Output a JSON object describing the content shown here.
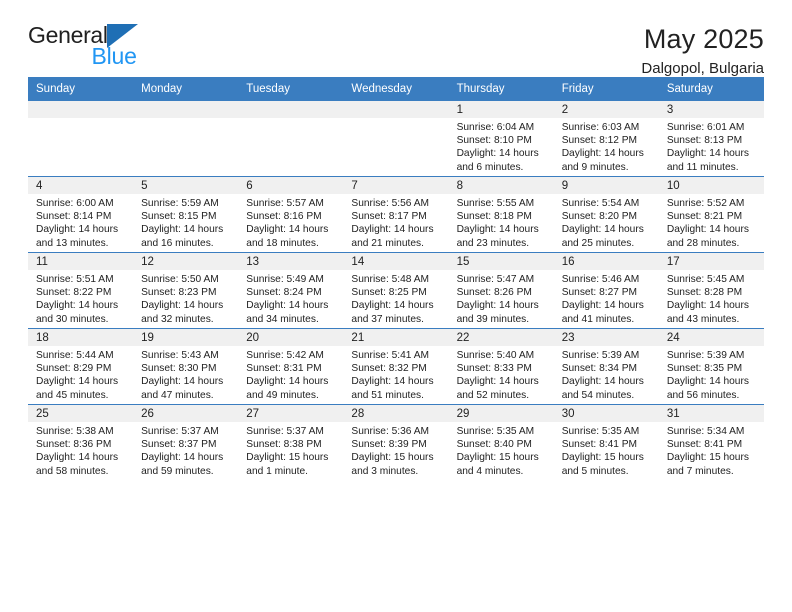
{
  "brand": {
    "name_part1": "General",
    "name_part2": "Blue",
    "accent_color": "#2196f3",
    "triangle_color": "#1f6fb5"
  },
  "header": {
    "title": "May 2025",
    "location": "Dalgopol, Bulgaria"
  },
  "calendar": {
    "header_bg": "#3a7dc0",
    "header_text_color": "#ffffff",
    "daynum_bg": "#f0f0f0",
    "weekday_headers": [
      "Sunday",
      "Monday",
      "Tuesday",
      "Wednesday",
      "Thursday",
      "Friday",
      "Saturday"
    ],
    "weeks": [
      [
        {
          "day": "",
          "empty": true,
          "sunrise": "",
          "sunset": "",
          "daylight_line1": "",
          "daylight_line2": ""
        },
        {
          "day": "",
          "empty": true,
          "sunrise": "",
          "sunset": "",
          "daylight_line1": "",
          "daylight_line2": ""
        },
        {
          "day": "",
          "empty": true,
          "sunrise": "",
          "sunset": "",
          "daylight_line1": "",
          "daylight_line2": ""
        },
        {
          "day": "",
          "empty": true,
          "sunrise": "",
          "sunset": "",
          "daylight_line1": "",
          "daylight_line2": ""
        },
        {
          "day": "1",
          "empty": false,
          "sunrise": "Sunrise: 6:04 AM",
          "sunset": "Sunset: 8:10 PM",
          "daylight_line1": "Daylight: 14 hours",
          "daylight_line2": "and 6 minutes."
        },
        {
          "day": "2",
          "empty": false,
          "sunrise": "Sunrise: 6:03 AM",
          "sunset": "Sunset: 8:12 PM",
          "daylight_line1": "Daylight: 14 hours",
          "daylight_line2": "and 9 minutes."
        },
        {
          "day": "3",
          "empty": false,
          "sunrise": "Sunrise: 6:01 AM",
          "sunset": "Sunset: 8:13 PM",
          "daylight_line1": "Daylight: 14 hours",
          "daylight_line2": "and 11 minutes."
        }
      ],
      [
        {
          "day": "4",
          "empty": false,
          "sunrise": "Sunrise: 6:00 AM",
          "sunset": "Sunset: 8:14 PM",
          "daylight_line1": "Daylight: 14 hours",
          "daylight_line2": "and 13 minutes."
        },
        {
          "day": "5",
          "empty": false,
          "sunrise": "Sunrise: 5:59 AM",
          "sunset": "Sunset: 8:15 PM",
          "daylight_line1": "Daylight: 14 hours",
          "daylight_line2": "and 16 minutes."
        },
        {
          "day": "6",
          "empty": false,
          "sunrise": "Sunrise: 5:57 AM",
          "sunset": "Sunset: 8:16 PM",
          "daylight_line1": "Daylight: 14 hours",
          "daylight_line2": "and 18 minutes."
        },
        {
          "day": "7",
          "empty": false,
          "sunrise": "Sunrise: 5:56 AM",
          "sunset": "Sunset: 8:17 PM",
          "daylight_line1": "Daylight: 14 hours",
          "daylight_line2": "and 21 minutes."
        },
        {
          "day": "8",
          "empty": false,
          "sunrise": "Sunrise: 5:55 AM",
          "sunset": "Sunset: 8:18 PM",
          "daylight_line1": "Daylight: 14 hours",
          "daylight_line2": "and 23 minutes."
        },
        {
          "day": "9",
          "empty": false,
          "sunrise": "Sunrise: 5:54 AM",
          "sunset": "Sunset: 8:20 PM",
          "daylight_line1": "Daylight: 14 hours",
          "daylight_line2": "and 25 minutes."
        },
        {
          "day": "10",
          "empty": false,
          "sunrise": "Sunrise: 5:52 AM",
          "sunset": "Sunset: 8:21 PM",
          "daylight_line1": "Daylight: 14 hours",
          "daylight_line2": "and 28 minutes."
        }
      ],
      [
        {
          "day": "11",
          "empty": false,
          "sunrise": "Sunrise: 5:51 AM",
          "sunset": "Sunset: 8:22 PM",
          "daylight_line1": "Daylight: 14 hours",
          "daylight_line2": "and 30 minutes."
        },
        {
          "day": "12",
          "empty": false,
          "sunrise": "Sunrise: 5:50 AM",
          "sunset": "Sunset: 8:23 PM",
          "daylight_line1": "Daylight: 14 hours",
          "daylight_line2": "and 32 minutes."
        },
        {
          "day": "13",
          "empty": false,
          "sunrise": "Sunrise: 5:49 AM",
          "sunset": "Sunset: 8:24 PM",
          "daylight_line1": "Daylight: 14 hours",
          "daylight_line2": "and 34 minutes."
        },
        {
          "day": "14",
          "empty": false,
          "sunrise": "Sunrise: 5:48 AM",
          "sunset": "Sunset: 8:25 PM",
          "daylight_line1": "Daylight: 14 hours",
          "daylight_line2": "and 37 minutes."
        },
        {
          "day": "15",
          "empty": false,
          "sunrise": "Sunrise: 5:47 AM",
          "sunset": "Sunset: 8:26 PM",
          "daylight_line1": "Daylight: 14 hours",
          "daylight_line2": "and 39 minutes."
        },
        {
          "day": "16",
          "empty": false,
          "sunrise": "Sunrise: 5:46 AM",
          "sunset": "Sunset: 8:27 PM",
          "daylight_line1": "Daylight: 14 hours",
          "daylight_line2": "and 41 minutes."
        },
        {
          "day": "17",
          "empty": false,
          "sunrise": "Sunrise: 5:45 AM",
          "sunset": "Sunset: 8:28 PM",
          "daylight_line1": "Daylight: 14 hours",
          "daylight_line2": "and 43 minutes."
        }
      ],
      [
        {
          "day": "18",
          "empty": false,
          "sunrise": "Sunrise: 5:44 AM",
          "sunset": "Sunset: 8:29 PM",
          "daylight_line1": "Daylight: 14 hours",
          "daylight_line2": "and 45 minutes."
        },
        {
          "day": "19",
          "empty": false,
          "sunrise": "Sunrise: 5:43 AM",
          "sunset": "Sunset: 8:30 PM",
          "daylight_line1": "Daylight: 14 hours",
          "daylight_line2": "and 47 minutes."
        },
        {
          "day": "20",
          "empty": false,
          "sunrise": "Sunrise: 5:42 AM",
          "sunset": "Sunset: 8:31 PM",
          "daylight_line1": "Daylight: 14 hours",
          "daylight_line2": "and 49 minutes."
        },
        {
          "day": "21",
          "empty": false,
          "sunrise": "Sunrise: 5:41 AM",
          "sunset": "Sunset: 8:32 PM",
          "daylight_line1": "Daylight: 14 hours",
          "daylight_line2": "and 51 minutes."
        },
        {
          "day": "22",
          "empty": false,
          "sunrise": "Sunrise: 5:40 AM",
          "sunset": "Sunset: 8:33 PM",
          "daylight_line1": "Daylight: 14 hours",
          "daylight_line2": "and 52 minutes."
        },
        {
          "day": "23",
          "empty": false,
          "sunrise": "Sunrise: 5:39 AM",
          "sunset": "Sunset: 8:34 PM",
          "daylight_line1": "Daylight: 14 hours",
          "daylight_line2": "and 54 minutes."
        },
        {
          "day": "24",
          "empty": false,
          "sunrise": "Sunrise: 5:39 AM",
          "sunset": "Sunset: 8:35 PM",
          "daylight_line1": "Daylight: 14 hours",
          "daylight_line2": "and 56 minutes."
        }
      ],
      [
        {
          "day": "25",
          "empty": false,
          "sunrise": "Sunrise: 5:38 AM",
          "sunset": "Sunset: 8:36 PM",
          "daylight_line1": "Daylight: 14 hours",
          "daylight_line2": "and 58 minutes."
        },
        {
          "day": "26",
          "empty": false,
          "sunrise": "Sunrise: 5:37 AM",
          "sunset": "Sunset: 8:37 PM",
          "daylight_line1": "Daylight: 14 hours",
          "daylight_line2": "and 59 minutes."
        },
        {
          "day": "27",
          "empty": false,
          "sunrise": "Sunrise: 5:37 AM",
          "sunset": "Sunset: 8:38 PM",
          "daylight_line1": "Daylight: 15 hours",
          "daylight_line2": "and 1 minute."
        },
        {
          "day": "28",
          "empty": false,
          "sunrise": "Sunrise: 5:36 AM",
          "sunset": "Sunset: 8:39 PM",
          "daylight_line1": "Daylight: 15 hours",
          "daylight_line2": "and 3 minutes."
        },
        {
          "day": "29",
          "empty": false,
          "sunrise": "Sunrise: 5:35 AM",
          "sunset": "Sunset: 8:40 PM",
          "daylight_line1": "Daylight: 15 hours",
          "daylight_line2": "and 4 minutes."
        },
        {
          "day": "30",
          "empty": false,
          "sunrise": "Sunrise: 5:35 AM",
          "sunset": "Sunset: 8:41 PM",
          "daylight_line1": "Daylight: 15 hours",
          "daylight_line2": "and 5 minutes."
        },
        {
          "day": "31",
          "empty": false,
          "sunrise": "Sunrise: 5:34 AM",
          "sunset": "Sunset: 8:41 PM",
          "daylight_line1": "Daylight: 15 hours",
          "daylight_line2": "and 7 minutes."
        }
      ]
    ]
  }
}
